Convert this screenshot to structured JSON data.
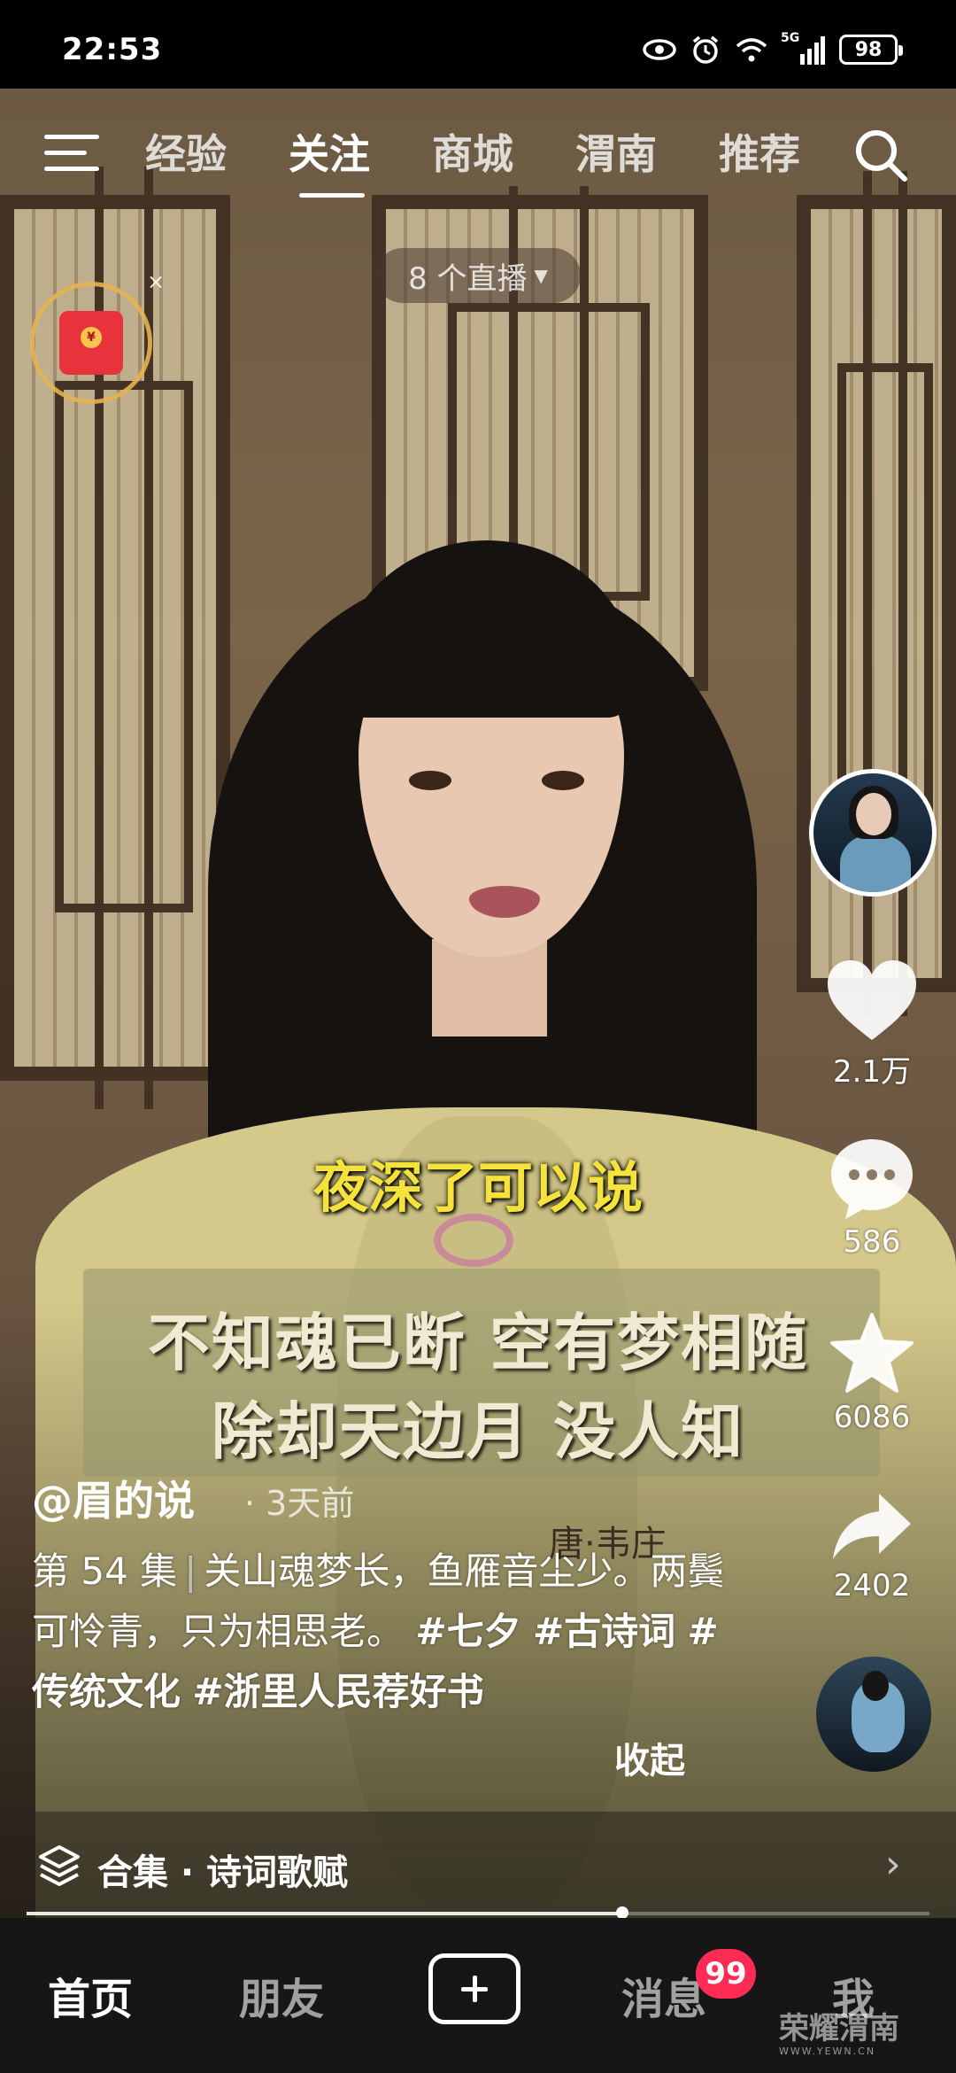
{
  "status_bar": {
    "time": "22:53",
    "network": "5G",
    "battery": "98"
  },
  "top_nav": {
    "tabs": [
      "经验",
      "关注",
      "商城",
      "渭南",
      "推荐"
    ],
    "active_tab": "关注",
    "live_count": "8 个直播"
  },
  "video": {
    "subtitle": "夜深了可以说",
    "poem_lines": [
      "不知魂已断  空有梦相随",
      "除却天边月  没人知"
    ],
    "poem_author": "唐·韦庄",
    "progress": 0.66
  },
  "actions": {
    "likes": "2.1万",
    "comments": "586",
    "favorites": "6086",
    "shares": "2402"
  },
  "caption": {
    "author": "@眉的说",
    "time_ago": "· 3天前",
    "episode": "第 54 集",
    "text": "关山魂梦长，鱼雁音尘少。两鬓可怜青，只为相思老。",
    "hashtags": [
      "#七夕",
      "#古诗词",
      "#传统文化",
      "#浙里人民荐好书"
    ],
    "collapse_label": "收起"
  },
  "collection": {
    "label": "合集 · 诗词歌赋"
  },
  "bottom_nav": {
    "items": [
      "首页",
      "朋友",
      "消息",
      "我"
    ],
    "active": "首页",
    "message_badge": "99"
  },
  "watermark": {
    "text": "荣耀渭南",
    "sub": "WWW.YEWN.CN"
  },
  "icons": [
    "menu-icon",
    "search-icon",
    "red-envelope-icon",
    "heart-icon",
    "comment-icon",
    "star-icon",
    "share-icon",
    "layers-icon",
    "chevron-right-icon",
    "plus-icon",
    "eye-icon",
    "alarm-icon",
    "wifi-icon",
    "signal-icon",
    "battery-icon"
  ]
}
